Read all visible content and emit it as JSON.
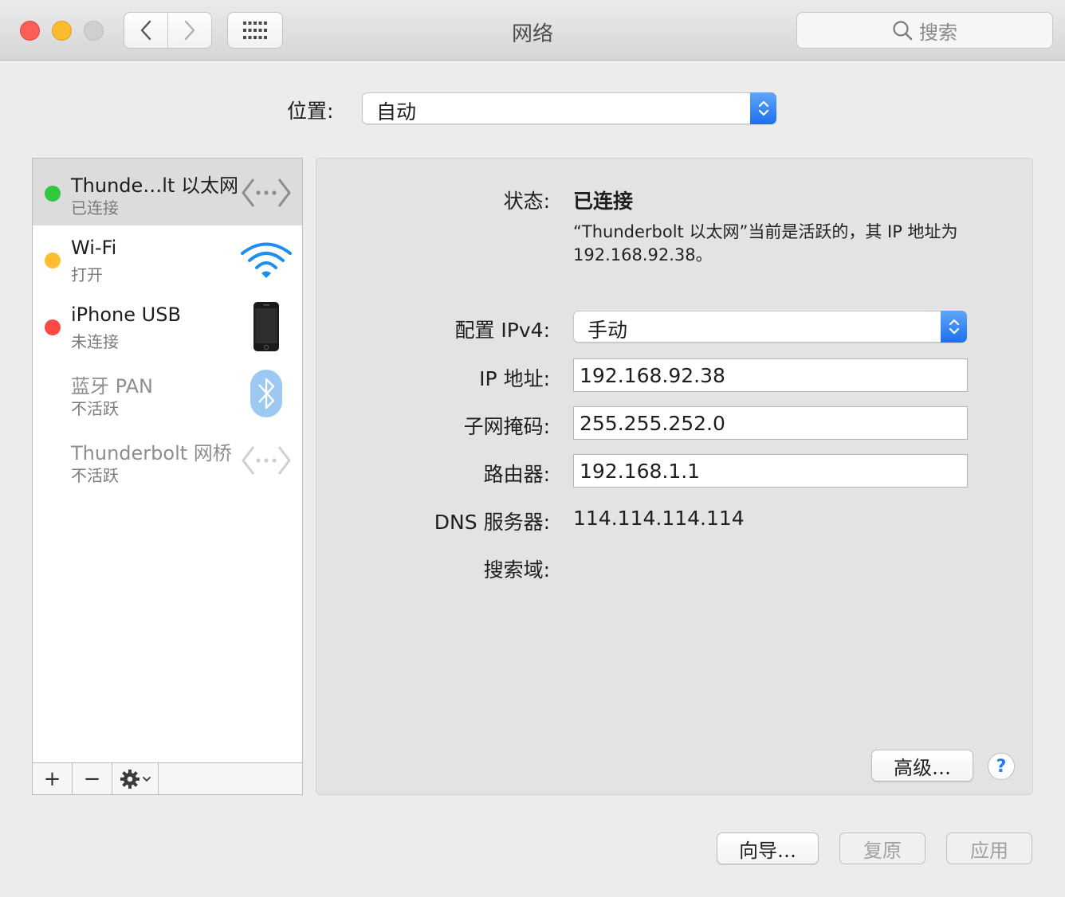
{
  "window": {
    "title": "网络"
  },
  "toolbar": {
    "search_placeholder": "搜索"
  },
  "location": {
    "label": "位置:",
    "value": "自动"
  },
  "services": [
    {
      "name": "Thunde…lt 以太网",
      "status": "已连接",
      "status_color": "#2fc840",
      "icon": "ethernet-icon",
      "selected": true
    },
    {
      "name": "Wi-Fi",
      "status": "打开",
      "status_color": "#fdbf2f",
      "icon": "wifi-icon"
    },
    {
      "name": "iPhone USB",
      "status": "未连接",
      "status_color": "#fb4a44",
      "icon": "iphone-icon"
    },
    {
      "name": "蓝牙 PAN",
      "status": "不活跃",
      "icon": "bluetooth-icon",
      "inactive": true
    },
    {
      "name": "Thunderbolt 网桥",
      "status": "不活跃",
      "icon": "bridge-icon",
      "inactive": true
    }
  ],
  "sidebar_toolbar": {
    "add": "+",
    "remove": "−"
  },
  "detail": {
    "status_label": "状态:",
    "status_value": "已连接",
    "status_desc": "“Thunderbolt 以太网”当前是活跃的，其 IP 地址为 192.168.92.38。",
    "ipv4_label": "配置 IPv4:",
    "ipv4_value": "手动",
    "ip_label": "IP 地址:",
    "ip_value": "192.168.92.38",
    "subnet_label": "子网掩码:",
    "subnet_value": "255.255.252.0",
    "router_label": "路由器:",
    "router_value": "192.168.1.1",
    "dns_label": "DNS 服务器:",
    "dns_value": "114.114.114.114",
    "search_domain_label": "搜索域:",
    "advanced_label": "高级…",
    "help_label": "?"
  },
  "footer": {
    "assistant_label": "向导…",
    "revert_label": "复原",
    "apply_label": "应用"
  },
  "colors": {
    "accent": "#1d6ff0"
  }
}
